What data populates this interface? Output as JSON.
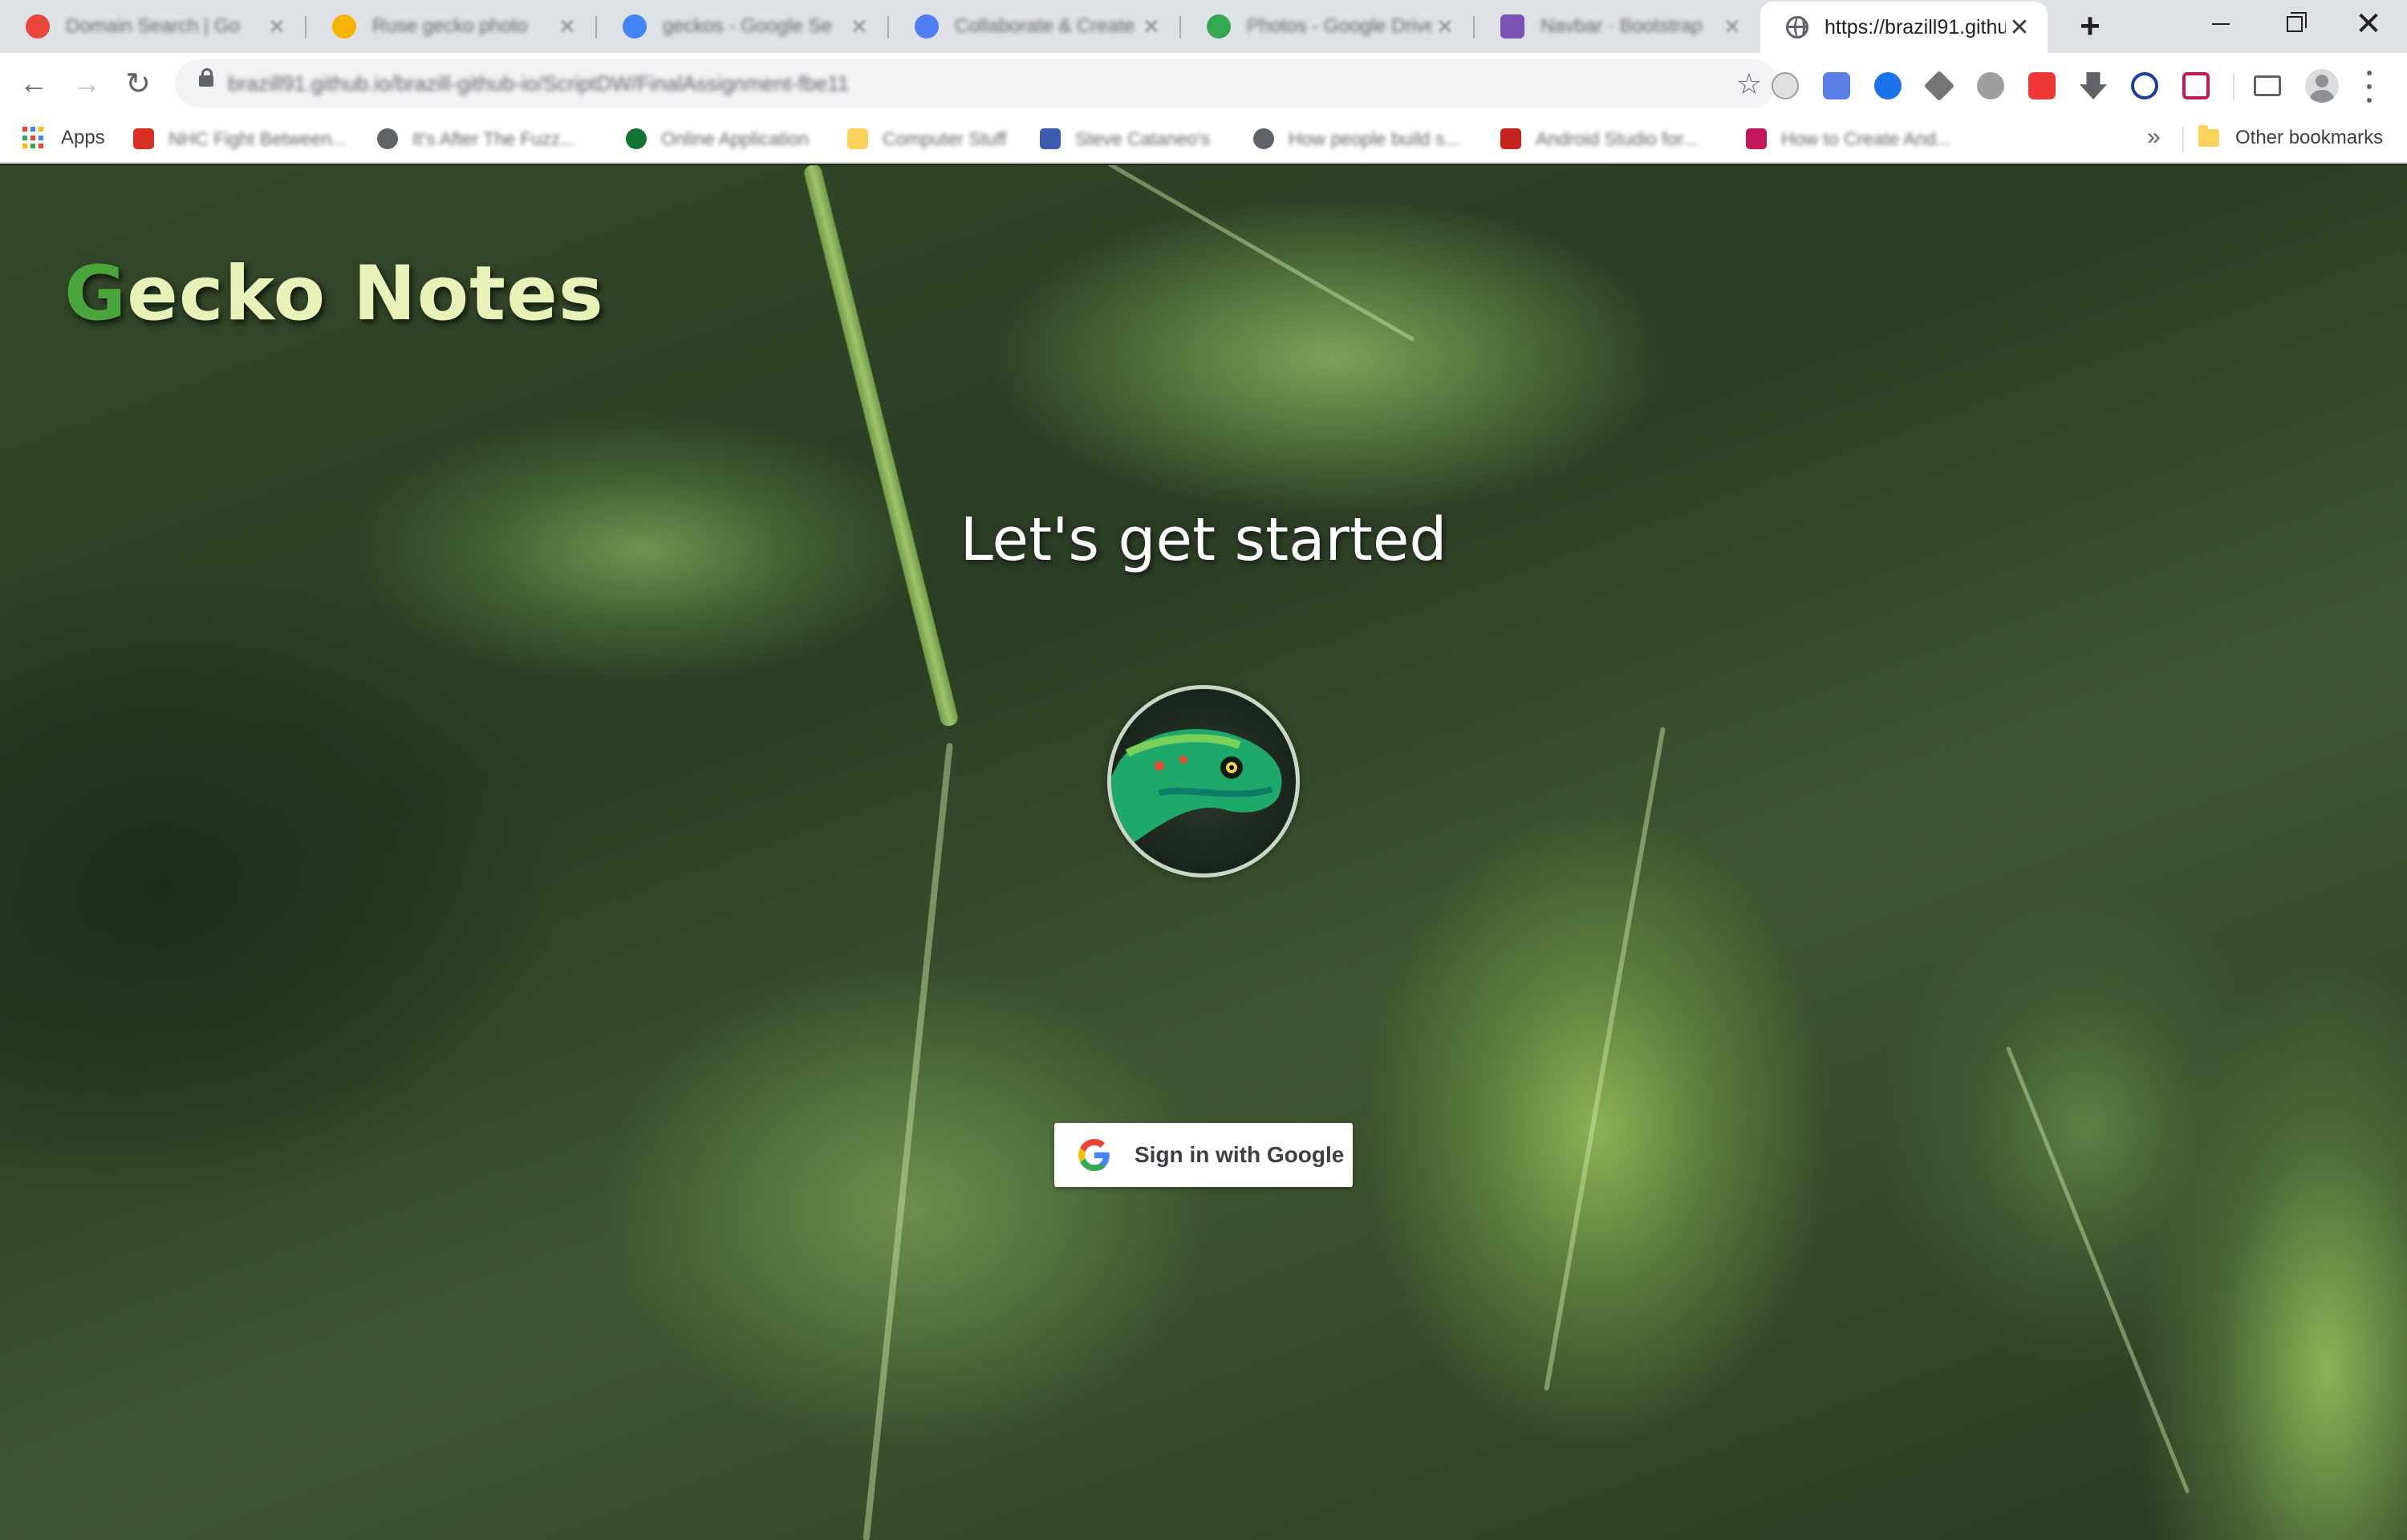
{
  "browser": {
    "tabs": [
      {
        "title": "Domain Search | Go",
        "icon_color": "#e8453c"
      },
      {
        "title": "Ruse gecko photo",
        "icon_color": "#f4b400"
      },
      {
        "title": "geckos - Google Se",
        "icon_color": "#4285f4"
      },
      {
        "title": "Collaborate & Create",
        "icon_color": "#4e7cf3"
      },
      {
        "title": "Photos - Google Drive",
        "icon_color": "#34a853"
      },
      {
        "title": "Navbar · Bootstrap",
        "icon_color": "#7952b3"
      }
    ],
    "active_tab": {
      "title": "https://brazill91.githul"
    },
    "url": "brazill91.github.io/brazill-github-io/ScriptDW/FinalAssignment-fbe11",
    "bookmarks": {
      "apps_label": "Apps",
      "items": [
        {
          "label": "NHC Fight Between...",
          "icon_color": "#d93025"
        },
        {
          "label": "It's After The Fuzz...",
          "icon_color": "#5f6368"
        },
        {
          "label": "Online Application",
          "icon_color": "#137333"
        },
        {
          "label": "Computer Stuff",
          "icon_color": "#fbd25b"
        },
        {
          "label": "Steve Cataneo's",
          "icon_color": "#3c5cb0"
        },
        {
          "label": "How people build s...",
          "icon_color": "#5f6368"
        },
        {
          "label": "Android Studio for...",
          "icon_color": "#c5221f"
        },
        {
          "label": "How to Create And...",
          "icon_color": "#c2185b"
        }
      ],
      "overflow": "»",
      "other_label": "Other bookmarks"
    }
  },
  "page": {
    "brand_first": "G",
    "brand_rest": "ecko Notes",
    "headline": "Let's get started",
    "signin_label": "Sign in with Google"
  }
}
